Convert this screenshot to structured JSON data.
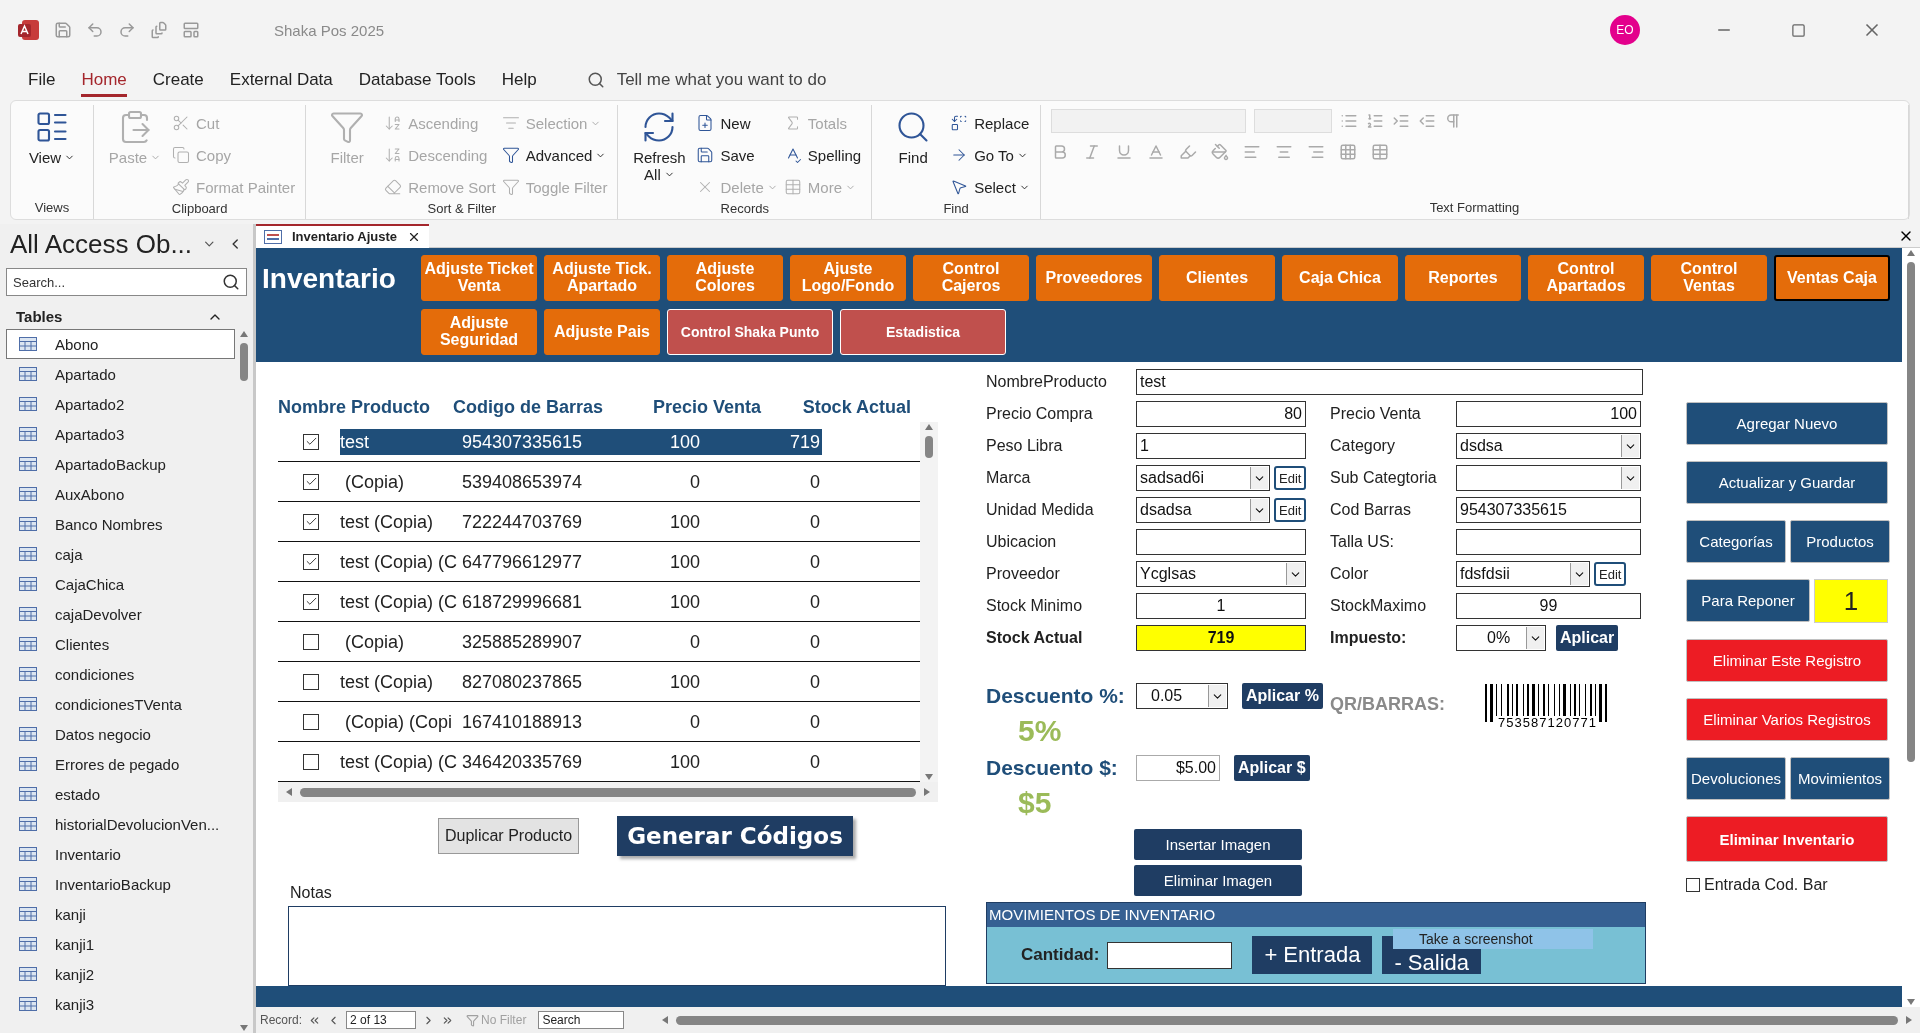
{
  "title_bar": {
    "app_title": "Shaka Pos 2025",
    "avatar": "EO"
  },
  "menu_tabs": [
    {
      "label": "File",
      "selected": false
    },
    {
      "label": "Home",
      "selected": true
    },
    {
      "label": "Create",
      "selected": false
    },
    {
      "label": "External Data",
      "selected": false
    },
    {
      "label": "Database Tools",
      "selected": false
    },
    {
      "label": "Help",
      "selected": false
    }
  ],
  "tell_me": {
    "placeholder": "Tell me what you want to do"
  },
  "ribbon": [
    {
      "label": "Views",
      "items": [
        {
          "label": "View",
          "kind": "large",
          "disabled": false,
          "dropdown": true
        }
      ]
    },
    {
      "label": "Clipboard",
      "items": [
        {
          "label": "Paste",
          "kind": "large",
          "disabled": true,
          "dropdown": true
        },
        {
          "label": "Cut",
          "kind": "small",
          "disabled": true,
          "dropdown": false
        },
        {
          "label": "Copy",
          "kind": "small",
          "disabled": true,
          "dropdown": false
        },
        {
          "label": "Format Painter",
          "kind": "small",
          "disabled": true,
          "dropdown": false
        }
      ]
    },
    {
      "label": "Sort & Filter",
      "items": [
        {
          "label": "Filter",
          "kind": "large",
          "disabled": true,
          "dropdown": false
        },
        {
          "label": "Ascending",
          "kind": "small",
          "disabled": true,
          "dropdown": false
        },
        {
          "label": "Descending",
          "kind": "small",
          "disabled": true,
          "dropdown": false
        },
        {
          "label": "Remove Sort",
          "kind": "small",
          "disabled": true,
          "dropdown": false
        },
        {
          "label": "Selection",
          "kind": "small",
          "disabled": true,
          "dropdown": true
        },
        {
          "label": "Advanced",
          "kind": "small",
          "disabled": false,
          "dropdown": true
        },
        {
          "label": "Toggle Filter",
          "kind": "small",
          "disabled": true,
          "dropdown": false
        }
      ]
    },
    {
      "label": "Records",
      "items": [
        {
          "label": "Refresh All",
          "kind": "large",
          "disabled": false,
          "dropdown": true
        },
        {
          "label": "New",
          "kind": "small",
          "disabled": false,
          "dropdown": false
        },
        {
          "label": "Save",
          "kind": "small",
          "disabled": false,
          "dropdown": false
        },
        {
          "label": "Delete",
          "kind": "small",
          "disabled": true,
          "dropdown": true
        },
        {
          "label": "Totals",
          "kind": "small",
          "disabled": true,
          "dropdown": false
        },
        {
          "label": "Spelling",
          "kind": "small",
          "disabled": false,
          "dropdown": false
        },
        {
          "label": "More",
          "kind": "small",
          "disabled": true,
          "dropdown": true
        }
      ]
    },
    {
      "label": "Find",
      "items": [
        {
          "label": "Find",
          "kind": "large",
          "disabled": false,
          "dropdown": false
        },
        {
          "label": "Replace",
          "kind": "small",
          "disabled": false,
          "dropdown": false
        },
        {
          "label": "Go To",
          "kind": "small",
          "disabled": false,
          "dropdown": true
        },
        {
          "label": "Select",
          "kind": "small",
          "disabled": false,
          "dropdown": true
        }
      ]
    },
    {
      "label": "Text Formatting"
    }
  ],
  "nav_pane": {
    "title": "All Access Ob...",
    "search_placeholder": "Search...",
    "section": "Tables",
    "items": [
      {
        "label": "Abono",
        "selected": true
      },
      {
        "label": "Apartado",
        "selected": false
      },
      {
        "label": "Apartado2",
        "selected": false
      },
      {
        "label": "Apartado3",
        "selected": false
      },
      {
        "label": "ApartadoBackup",
        "selected": false
      },
      {
        "label": "AuxAbono",
        "selected": false
      },
      {
        "label": "Banco Nombres",
        "selected": false
      },
      {
        "label": "caja",
        "selected": false
      },
      {
        "label": "CajaChica",
        "selected": false
      },
      {
        "label": "cajaDevolver",
        "selected": false
      },
      {
        "label": "Clientes",
        "selected": false
      },
      {
        "label": "condiciones",
        "selected": false
      },
      {
        "label": "condicionesTVenta",
        "selected": false
      },
      {
        "label": "Datos negocio",
        "selected": false
      },
      {
        "label": "Errores de pegado",
        "selected": false
      },
      {
        "label": "estado",
        "selected": false
      },
      {
        "label": "historialDevolucionVen...",
        "selected": false
      },
      {
        "label": "Inventario",
        "selected": false
      },
      {
        "label": "InventarioBackup",
        "selected": false
      },
      {
        "label": "kanji",
        "selected": false
      },
      {
        "label": "kanji1",
        "selected": false
      },
      {
        "label": "kanji2",
        "selected": false
      },
      {
        "label": "kanji3",
        "selected": false
      }
    ]
  },
  "document_tab": {
    "label": "Inventario Ajuste"
  },
  "header": {
    "title": "Inventario",
    "button_rows": [
      [
        {
          "label": "Adjuste Ticket Venta",
          "kind": "orange",
          "focused": false
        },
        {
          "label": "Adjuste Tick. Apartado",
          "kind": "orange",
          "focused": false
        },
        {
          "label": "Adjuste Colores",
          "kind": "orange",
          "focused": false
        },
        {
          "label": "Ajuste Logo/Fondo",
          "kind": "orange",
          "focused": false
        },
        {
          "label": "Control Cajeros",
          "kind": "orange",
          "focused": false
        },
        {
          "label": "Proveedores",
          "kind": "orange",
          "focused": false
        },
        {
          "label": "Clientes",
          "kind": "orange",
          "focused": false
        },
        {
          "label": "Caja Chica",
          "kind": "orange",
          "focused": false
        },
        {
          "label": "Reportes",
          "kind": "orange",
          "focused": false
        },
        {
          "label": "Control Apartados",
          "kind": "orange",
          "focused": false
        },
        {
          "label": "Control Ventas",
          "kind": "orange",
          "focused": false
        },
        {
          "label": "Ventas Caja",
          "kind": "orange",
          "focused": true
        }
      ],
      [
        {
          "label": "Adjuste Seguridad",
          "kind": "orange",
          "focused": false
        },
        {
          "label": "Adjuste Pais",
          "kind": "orange",
          "focused": false
        },
        {
          "label": "Control Shaka Punto",
          "kind": "red",
          "focused": false
        },
        {
          "label": "Estadistica",
          "kind": "red",
          "focused": false
        }
      ]
    ]
  },
  "grid": {
    "columns": [
      "Nombre Producto",
      "Codigo de Barras",
      "Precio Venta",
      "Stock Actual"
    ],
    "rows": [
      {
        "checked": true,
        "selected": true,
        "cells": [
          "test",
          "954307335615",
          "100",
          "719"
        ]
      },
      {
        "checked": true,
        "selected": false,
        "cells": [
          " (Copia)",
          "539408653974",
          "0",
          "0"
        ]
      },
      {
        "checked": true,
        "selected": false,
        "cells": [
          "test (Copia)",
          "722244703769",
          "100",
          "0"
        ]
      },
      {
        "checked": true,
        "selected": false,
        "cells": [
          "test (Copia) (C",
          "647796612977",
          "100",
          "0"
        ]
      },
      {
        "checked": true,
        "selected": false,
        "cells": [
          "test (Copia) (C",
          "618729996681",
          "100",
          "0"
        ]
      },
      {
        "checked": false,
        "selected": false,
        "cells": [
          " (Copia)",
          "325885289907",
          "0",
          "0"
        ]
      },
      {
        "checked": false,
        "selected": false,
        "cells": [
          "test (Copia)",
          "827080237865",
          "100",
          "0"
        ]
      },
      {
        "checked": false,
        "selected": false,
        "cells": [
          " (Copia) (Copi",
          "167410188913",
          "0",
          "0"
        ]
      },
      {
        "checked": false,
        "selected": false,
        "cells": [
          "test (Copia) (C",
          "346420335769",
          "100",
          "0"
        ]
      }
    ]
  },
  "grid_buttons": [
    "Duplicar Producto",
    "Generar Códigos"
  ],
  "notes": {
    "label": "Notas"
  },
  "field_rows": [
    [
      {
        "label": "NombreProducto",
        "value": "test",
        "kind": "wide"
      }
    ],
    [
      {
        "label": "Precio Compra",
        "value": "80",
        "kind": "number"
      },
      {
        "label": "Precio Venta",
        "value": "100",
        "kind": "number"
      }
    ],
    [
      {
        "label": "Peso Libra",
        "value": "1",
        "kind": "text"
      },
      {
        "label": "Category",
        "value": "dsdsa",
        "kind": "combo"
      }
    ],
    [
      {
        "label": "Marca",
        "value": "sadsad6i",
        "kind": "combo_edit",
        "edit": "Edit"
      },
      {
        "label": "Sub Categtoria",
        "kind": "combo"
      }
    ],
    [
      {
        "label": "Unidad Medida",
        "value": "dsadsa",
        "kind": "combo_edit",
        "edit": "Edit"
      },
      {
        "label": "Cod Barras",
        "value": "954307335615",
        "kind": "text"
      }
    ],
    [
      {
        "label": "Ubicacion",
        "kind": "text"
      },
      {
        "label": "Talla US:",
        "kind": "text"
      }
    ],
    [
      {
        "label": "Proveedor",
        "value": "Ycglsas",
        "kind": "combo"
      },
      {
        "label": "Color",
        "value": "fdsfdsii",
        "kind": "combo_edit",
        "edit": "Edit"
      }
    ],
    [
      {
        "label": "Stock Minimo",
        "value": "1",
        "kind": "center"
      },
      {
        "label": "StockMaximo",
        "value": "99",
        "kind": "center"
      }
    ],
    [
      {
        "label": "Stock Actual",
        "value": "719",
        "kind": "highlight"
      },
      {
        "label": "Impuesto:",
        "value": "0%",
        "kind": "tax",
        "button": "Aplicar"
      }
    ]
  ],
  "discounts": [
    {
      "label": "Descuento %:",
      "value": "0.05",
      "kind": "combo",
      "button": "Aplicar %",
      "display": "5%"
    },
    {
      "label": "Descuento $:",
      "value": "$5.00",
      "kind": "text",
      "button": "Aplicar $",
      "display": "$5"
    }
  ],
  "barcode": {
    "label": "QR/BARRAS:",
    "number": "753587120771"
  },
  "image_buttons": [
    "Insertar Imagen",
    "Eliminar Imagen"
  ],
  "movements": {
    "title": "MOVIMIENTOS DE INVENTARIO",
    "quantity_label": "Cantidad:",
    "buttons": [
      "+ Entrada",
      "- Salida"
    ],
    "tooltip": "Take a screenshot"
  },
  "side_buttons": [
    [
      {
        "label": "Agregar Nuevo",
        "kind": "blue"
      }
    ],
    [
      {
        "label": "Actualizar y Guardar",
        "kind": "blue"
      }
    ],
    [
      {
        "label": "Categorías",
        "kind": "blue"
      },
      {
        "label": "Productos",
        "kind": "blue"
      }
    ],
    [
      {
        "label": "Para Reponer",
        "kind": "blue"
      },
      {
        "label": "1",
        "kind": "counter"
      }
    ],
    [
      {
        "label": "Eliminar Este Registro",
        "kind": "red"
      }
    ],
    [
      {
        "label": "Eliminar Varios Registros",
        "kind": "red"
      }
    ],
    [
      {
        "label": "Devoluciones",
        "kind": "blue"
      },
      {
        "label": "Movimientos",
        "kind": "blue"
      }
    ],
    [
      {
        "label": "Eliminar Inventario",
        "kind": "danger"
      }
    ]
  ],
  "barcode_entry": {
    "label": "Entrada Cod. Bar",
    "checked": false
  },
  "record_nav": {
    "label": "Record:",
    "position": "2 of 13",
    "filter": "No Filter",
    "filter_active": false,
    "search_placeholder": "Search"
  }
}
